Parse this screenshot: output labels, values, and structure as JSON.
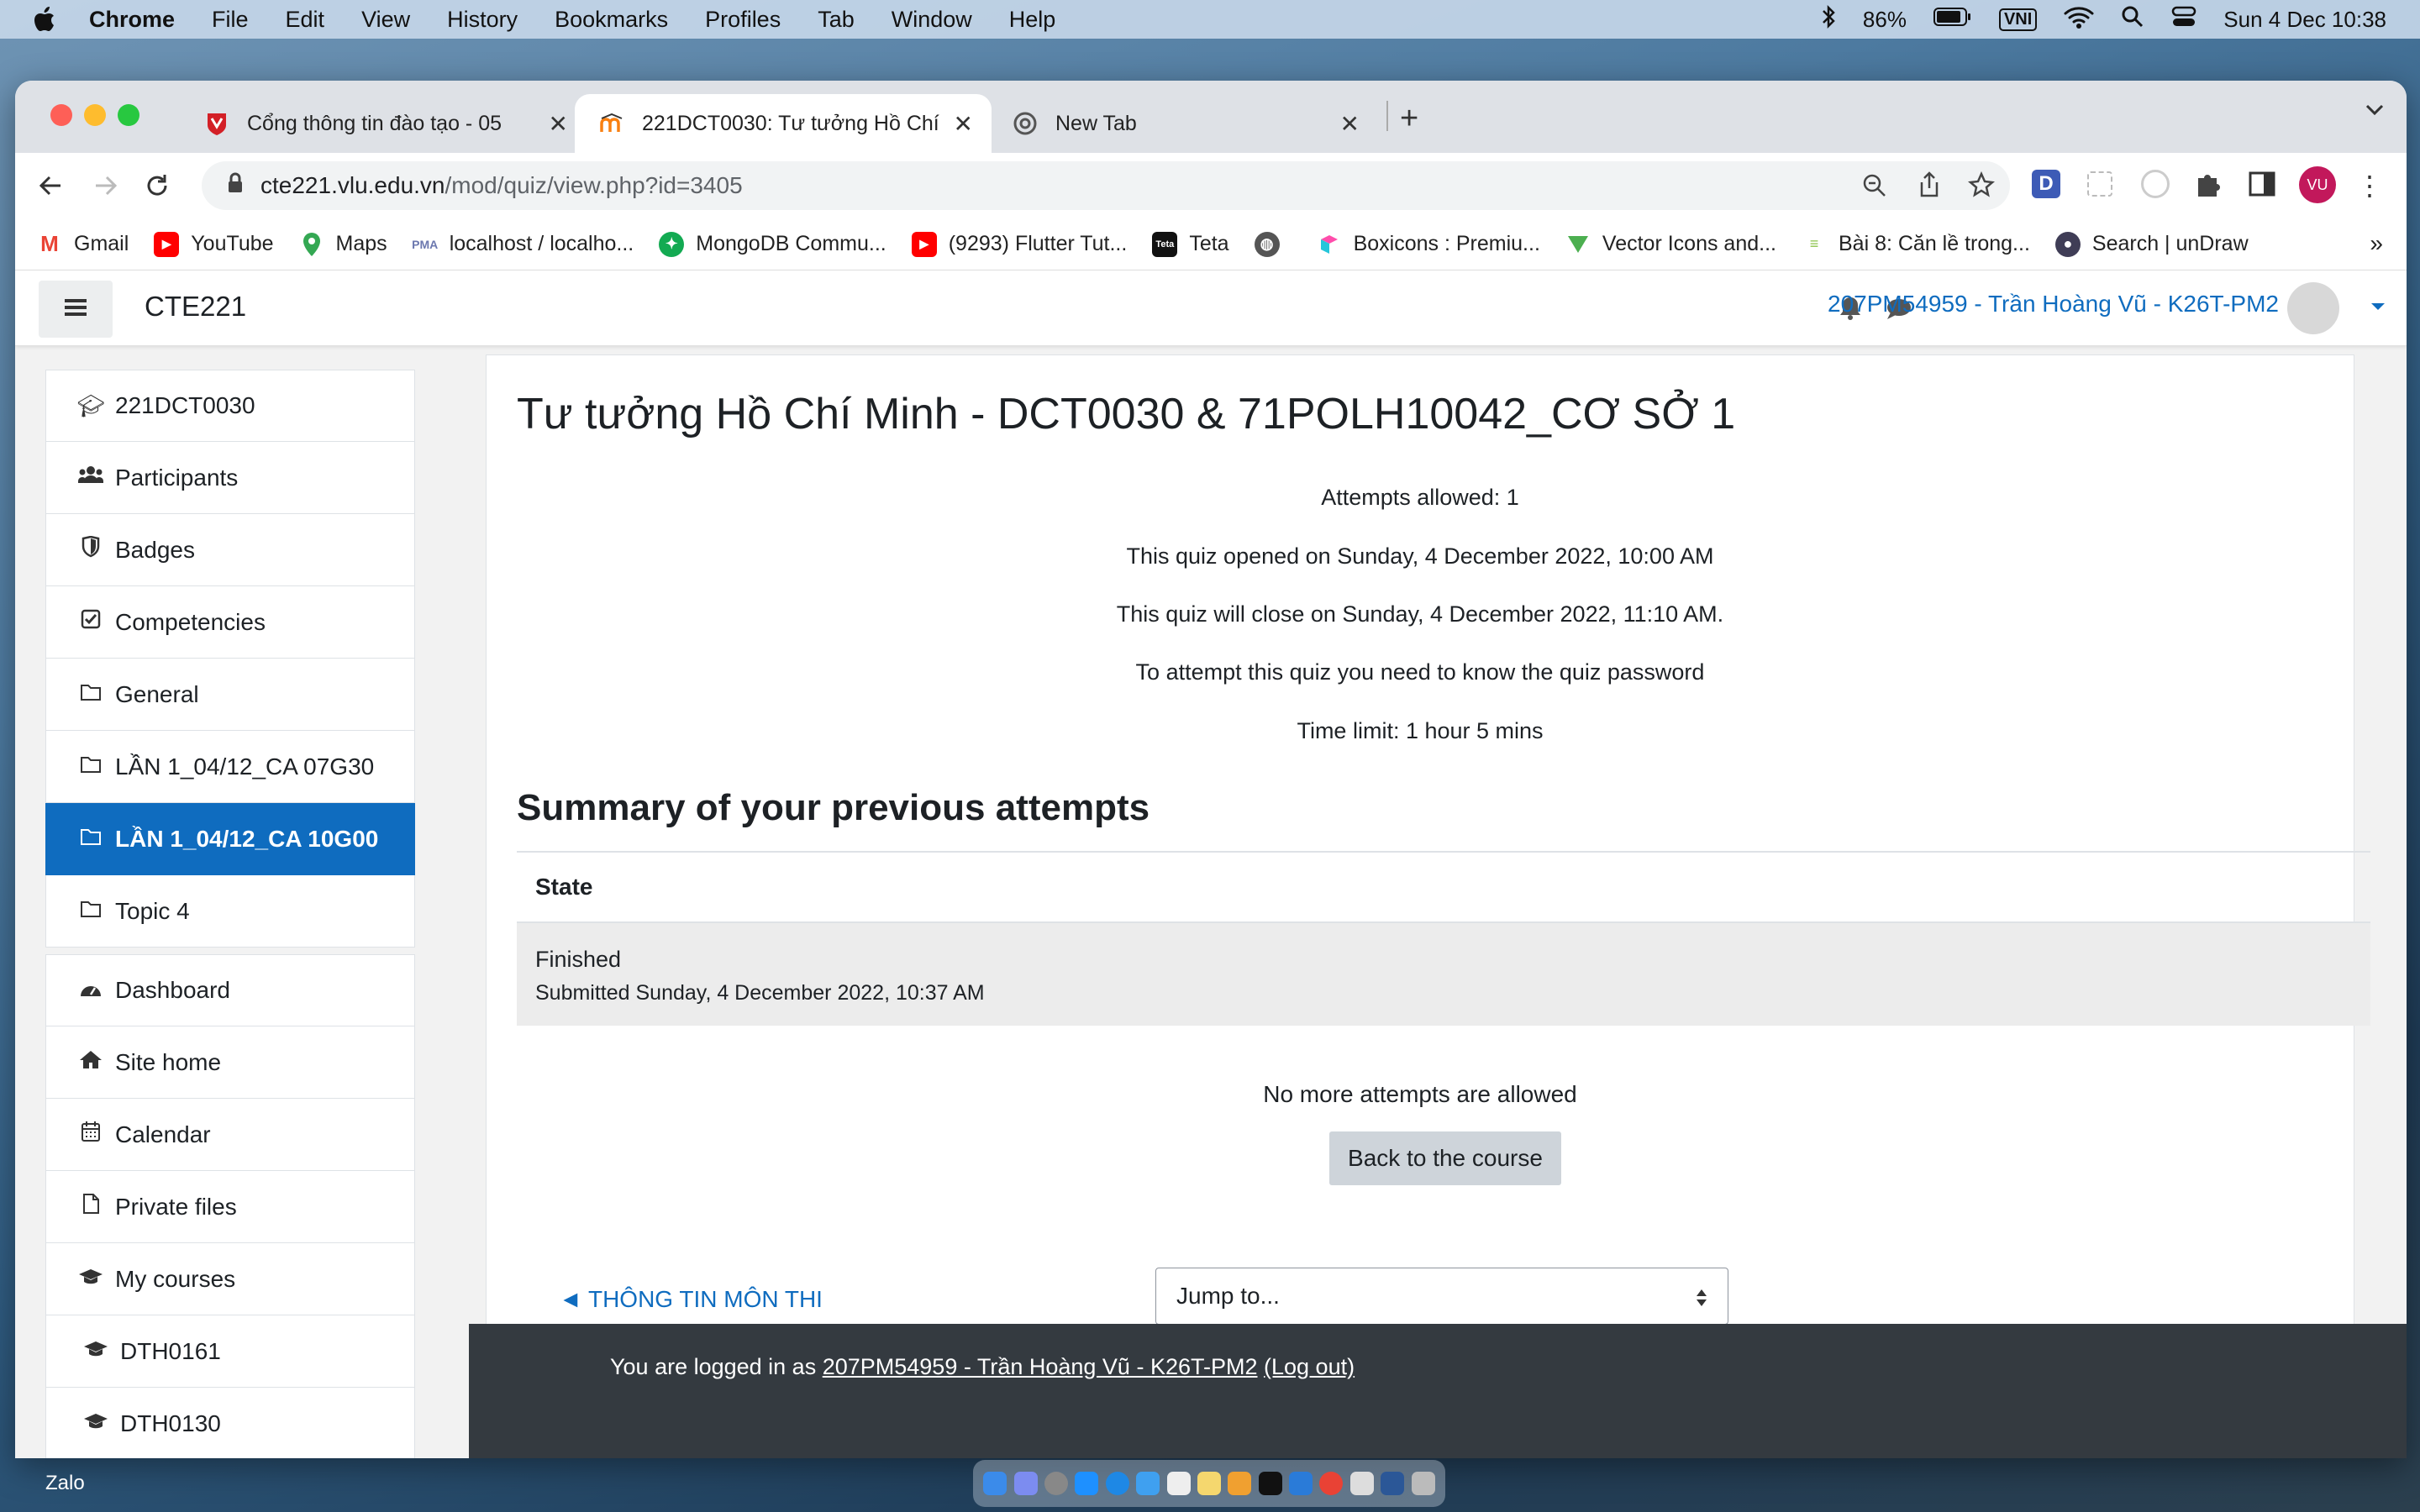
{
  "menubar": {
    "app": "Chrome",
    "items": [
      "File",
      "Edit",
      "View",
      "History",
      "Bookmarks",
      "Profiles",
      "Tab",
      "Window",
      "Help"
    ],
    "battery": "86%",
    "input_method": "VNI",
    "datetime": "Sun 4 Dec  10:38"
  },
  "tabs": [
    {
      "title": "Cổng thông tin đào tạo - 05",
      "icon": "vlu-shield-icon"
    },
    {
      "title": "221DCT0030: Tư tưởng Hồ Chí",
      "icon": "moodle-icon"
    },
    {
      "title": "New Tab",
      "icon": "chrome-icon"
    }
  ],
  "url": {
    "host": "cte221.vlu.edu.vn",
    "path": "/mod/quiz/view.php?id=3405"
  },
  "profile_initials": "VU",
  "bookmarks": [
    "Gmail",
    "YouTube",
    "Maps",
    "localhost / localho...",
    "MongoDB Commu...",
    "(9293) Flutter Tut...",
    "Teta",
    "",
    "Boxicons : Premiu...",
    "Vector Icons and...",
    "Bài 8: Căn lề trong...",
    "Search | unDraw"
  ],
  "site": {
    "name": "CTE221",
    "user": "207PM54959 - Trần Hoàng Vũ - K26T-PM2"
  },
  "drawer": {
    "course_items": [
      {
        "label": "221DCT0030",
        "icon": "graduation-cap-icon"
      },
      {
        "label": "Participants",
        "icon": "users-icon"
      },
      {
        "label": "Badges",
        "icon": "shield-icon"
      },
      {
        "label": "Competencies",
        "icon": "check-square-icon"
      },
      {
        "label": "General",
        "icon": "folder-icon"
      },
      {
        "label": "LẦN 1_04/12_CA 07G30",
        "icon": "folder-icon"
      },
      {
        "label": "LẦN 1_04/12_CA 10G00",
        "icon": "folder-icon"
      },
      {
        "label": "Topic 4",
        "icon": "folder-icon"
      }
    ],
    "site_items": [
      {
        "label": "Dashboard",
        "icon": "dashboard-icon"
      },
      {
        "label": "Site home",
        "icon": "home-icon"
      },
      {
        "label": "Calendar",
        "icon": "calendar-icon"
      },
      {
        "label": "Private files",
        "icon": "file-icon"
      },
      {
        "label": "My courses",
        "icon": "graduation-cap-icon"
      },
      {
        "label": "DTH0161",
        "icon": "graduation-cap-icon"
      },
      {
        "label": "DTH0130",
        "icon": "graduation-cap-icon"
      }
    ]
  },
  "quiz": {
    "title": "Tư tưởng Hồ Chí Minh - DCT0030 & 71POLH10042_CƠ SỞ 1",
    "info": [
      "Attempts allowed: 1",
      "This quiz opened on Sunday, 4 December 2022, 10:00 AM",
      "This quiz will close on Sunday, 4 December 2022, 11:10 AM.",
      "To attempt this quiz you need to know the quiz password",
      "Time limit: 1 hour 5 mins"
    ],
    "summary_heading": "Summary of your previous attempts",
    "table_header": "State",
    "attempt_state": "Finished",
    "attempt_submitted": "Submitted Sunday, 4 December 2022, 10:37 AM",
    "no_more": "No more attempts are allowed",
    "back_button": "Back to the course",
    "prev_link": "◄ THÔNG TIN MÔN THI",
    "jump_placeholder": "Jump to..."
  },
  "footer": {
    "prefix": "You are logged in as ",
    "user_link": "207PM54959 - Trần Hoàng Vũ - K26T-PM2",
    "logout": "(Log out)"
  },
  "desktop_label": "Zalo",
  "colors": {
    "accent": "#0f6cbf",
    "footer": "#343a40"
  }
}
